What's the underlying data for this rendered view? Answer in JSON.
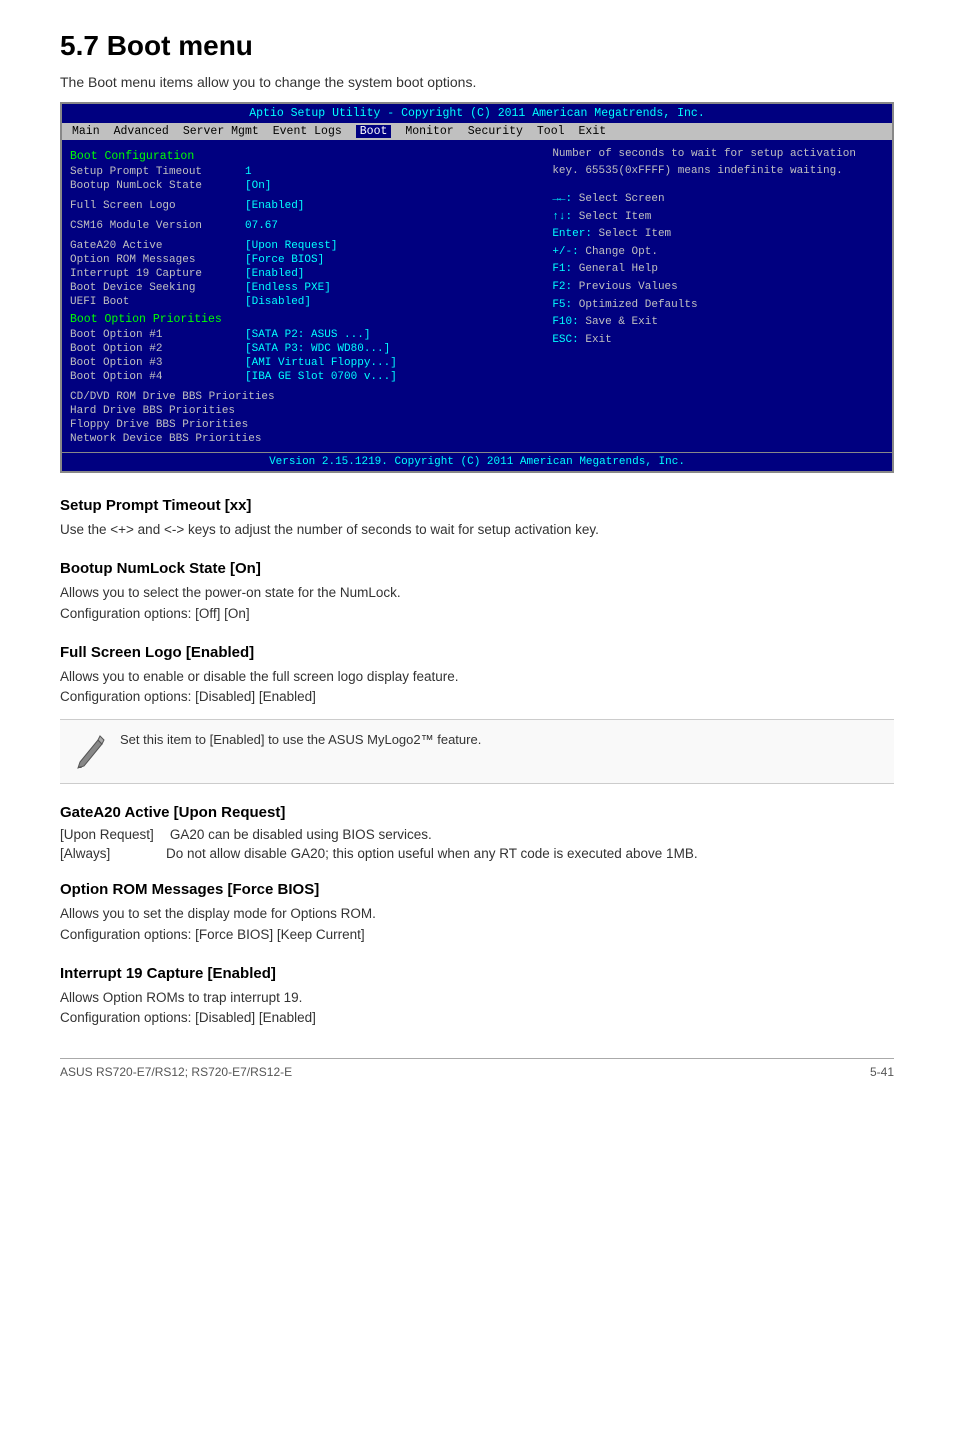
{
  "page": {
    "title": "5.7   Boot menu",
    "intro": "The Boot menu items allow you to change the system boot options."
  },
  "bios": {
    "title_bar": "Aptio Setup Utility - Copyright (C) 2011 American Megatrends, Inc.",
    "menu_items": [
      "Main",
      "Advanced",
      "Server Mgmt",
      "Event Logs",
      "Boot",
      "Monitor",
      "Security",
      "Tool",
      "Exit"
    ],
    "active_menu": "Boot",
    "left_panel": {
      "sections": [
        {
          "title": "Boot Configuration",
          "rows": [
            {
              "label": "Setup Prompt Timeout",
              "value": "1"
            },
            {
              "label": "Bootup NumLock State",
              "value": "[On]"
            }
          ]
        },
        {
          "title": "",
          "rows": [
            {
              "label": "Full Screen Logo",
              "value": "[Enabled]"
            }
          ]
        },
        {
          "title": "",
          "rows": [
            {
              "label": "CSM16 Module Version",
              "value": "    07.67"
            }
          ]
        },
        {
          "title": "",
          "rows": [
            {
              "label": "GateA20 Active",
              "value": "[Upon Request]"
            },
            {
              "label": "Option ROM Messages",
              "value": "[Force BIOS]"
            },
            {
              "label": "Interrupt 19 Capture",
              "value": "[Enabled]"
            },
            {
              "label": "Boot Device Seeking",
              "value": "[Endless PXE]"
            },
            {
              "label": "UEFI Boot",
              "value": "[Disabled]"
            }
          ]
        },
        {
          "title": "Boot Option Priorities",
          "rows": [
            {
              "label": "Boot Option #1",
              "value": "[SATA  P2: ASUS    ...]"
            },
            {
              "label": "Boot Option #2",
              "value": "[SATA  P3: WDC WD80...]"
            },
            {
              "label": "Boot Option #3",
              "value": "[AMI Virtual Floppy...]"
            },
            {
              "label": "Boot Option #4",
              "value": "[IBA GE Slot 0700 v...]"
            }
          ]
        },
        {
          "title": "",
          "rows": [
            {
              "label": "CD/DVD ROM Drive BBS Priorities",
              "value": ""
            },
            {
              "label": "Hard Drive BBS Priorities",
              "value": ""
            },
            {
              "label": "Floppy Drive BBS Priorities",
              "value": ""
            },
            {
              "label": "Network Device BBS Priorities",
              "value": ""
            }
          ]
        }
      ]
    },
    "right_panel": {
      "help_text": "Number of seconds to wait for\nsetup activation key.\n65535(0xFFFF) means indefinite\nwaiting.",
      "keys": [
        {
          "key": "→←:",
          "desc": "Select Screen"
        },
        {
          "key": "↑↓:",
          "desc": "Select Item"
        },
        {
          "key": "Enter:",
          "desc": "Select Item"
        },
        {
          "key": "+/-:",
          "desc": "Change Opt."
        },
        {
          "key": "F1:",
          "desc": "General Help"
        },
        {
          "key": "F2:",
          "desc": "Previous Values"
        },
        {
          "key": "F5:",
          "desc": "Optimized Defaults"
        },
        {
          "key": "F10:",
          "desc": "Save & Exit"
        },
        {
          "key": "ESC:",
          "desc": "Exit"
        }
      ]
    },
    "footer": "Version 2.15.1219. Copyright (C) 2011 American Megatrends, Inc."
  },
  "sections": [
    {
      "id": "setup-prompt-timeout",
      "heading": "Setup Prompt Timeout [xx]",
      "body": "Use the <+> and <-> keys to adjust the number of seconds to wait for setup activation key."
    },
    {
      "id": "bootup-numlock",
      "heading": "Bootup NumLock State [On]",
      "body": "Allows you to select the power-on state for the NumLock.\nConfiguration options: [Off] [On]"
    },
    {
      "id": "full-screen-logo",
      "heading": "Full Screen Logo [Enabled]",
      "body": "Allows you to enable or disable the full screen logo display feature.\nConfiguration options: [Disabled] [Enabled]",
      "note": "Set this item to [Enabled] to use the ASUS MyLogo2™ feature."
    },
    {
      "id": "gatea20",
      "heading": "GateA20 Active [Upon Request]",
      "definitions": [
        {
          "term": "[Upon Request]",
          "desc": "GA20 can be disabled using BIOS services."
        },
        {
          "term": "[Always]",
          "desc": "Do not allow disable GA20; this option useful when any RT code is executed above 1MB."
        }
      ]
    },
    {
      "id": "option-rom",
      "heading": "Option ROM Messages [Force BIOS]",
      "body": "Allows you to set the display mode for Options ROM.\nConfiguration options: [Force BIOS] [Keep Current]"
    },
    {
      "id": "interrupt-19",
      "heading": "Interrupt 19 Capture [Enabled]",
      "body": "Allows Option ROMs to trap interrupt 19.\nConfiguration options: [Disabled] [Enabled]"
    }
  ],
  "footer": {
    "left": "ASUS RS720-E7/RS12; RS720-E7/RS12-E",
    "right": "5-41"
  }
}
